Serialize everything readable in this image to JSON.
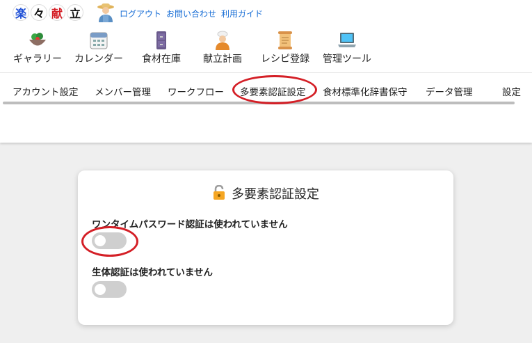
{
  "logo": {
    "chars": [
      "楽",
      "々",
      "献",
      "立"
    ],
    "colors": [
      "#1e4fd6",
      "#111111",
      "#d41f26",
      "#111111"
    ]
  },
  "toplinks": {
    "logout": "ログアウト",
    "contact": "お問い合わせ",
    "guide": "利用ガイド"
  },
  "mainnav": [
    {
      "label": "ギャラリー",
      "icon": "salad-bowl-icon"
    },
    {
      "label": "カレンダー",
      "icon": "calendar-icon"
    },
    {
      "label": "食材在庫",
      "icon": "cabinet-icon"
    },
    {
      "label": "献立計画",
      "icon": "cook-icon"
    },
    {
      "label": "レシピ登録",
      "icon": "scroll-icon"
    },
    {
      "label": "管理ツール",
      "icon": "laptop-icon"
    }
  ],
  "subnav": [
    {
      "label": "アカウント設定"
    },
    {
      "label": "メンバー管理"
    },
    {
      "label": "ワークフロー"
    },
    {
      "label": "多要素認証設定"
    },
    {
      "label": "食材標準化辞書保守"
    },
    {
      "label": "データ管理"
    },
    {
      "label": "設定"
    }
  ],
  "card": {
    "title": "多要素認証設定",
    "otp_label": "ワンタイムパスワード認証は使われていません",
    "otp_enabled": false,
    "bio_label": "生体認証は使われていません",
    "bio_enabled": false
  },
  "accent": {
    "link": "#1a6fd6",
    "annotation": "#d41f26"
  }
}
